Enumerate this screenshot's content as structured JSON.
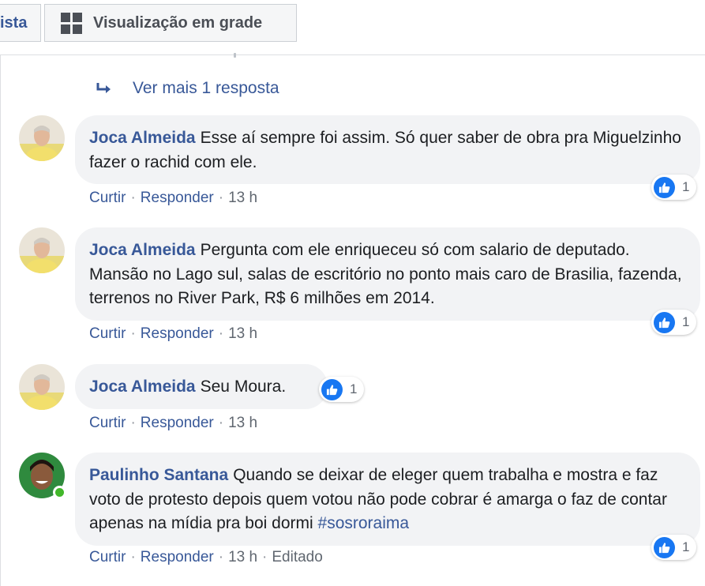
{
  "view_toggle": {
    "list_label": "ista",
    "grid_label": "Visualização em grade"
  },
  "more_replies": "Ver mais 1 resposta",
  "labels": {
    "like": "Curtir",
    "reply": "Responder",
    "edited": "Editado"
  },
  "comments": [
    {
      "author": "Joca Almeida",
      "text": "Esse aí sempre foi assim. Só quer saber de obra pra Miguelzinho fazer o rachid com ele.",
      "time": "13 h",
      "reactions": "1",
      "online": false
    },
    {
      "author": "Joca Almeida",
      "text": "Pergunta com ele enriqueceu só com salario de deputado. Mansão no Lago sul, salas de escritório no ponto mais caro de Brasilia, fazenda, terrenos no River Park, R$ 6 milhões em 2014.",
      "time": "13 h",
      "reactions": "1",
      "online": false
    },
    {
      "author": "Joca Almeida",
      "text": "Seu Moura.",
      "time": "13 h",
      "reactions": "1",
      "online": false
    },
    {
      "author": "Paulinho Santana",
      "text": "Quando se deixar de eleger quem trabalha e mostra e faz voto de protesto depois quem votou não pode cobrar é amarga o faz de contar apenas na mídia pra boi dormi",
      "hashtag": "#sosroraima",
      "time": "13 h",
      "reactions": "1",
      "online": true
    }
  ],
  "icons": {
    "reply_arrow": "reply-arrow-icon",
    "like": "like-thumb-icon",
    "grid": "grid-icon"
  },
  "colors": {
    "link": "#385898",
    "bubble": "#f2f3f5",
    "like_blue": "#1877f2",
    "online_green": "#42b72a"
  }
}
